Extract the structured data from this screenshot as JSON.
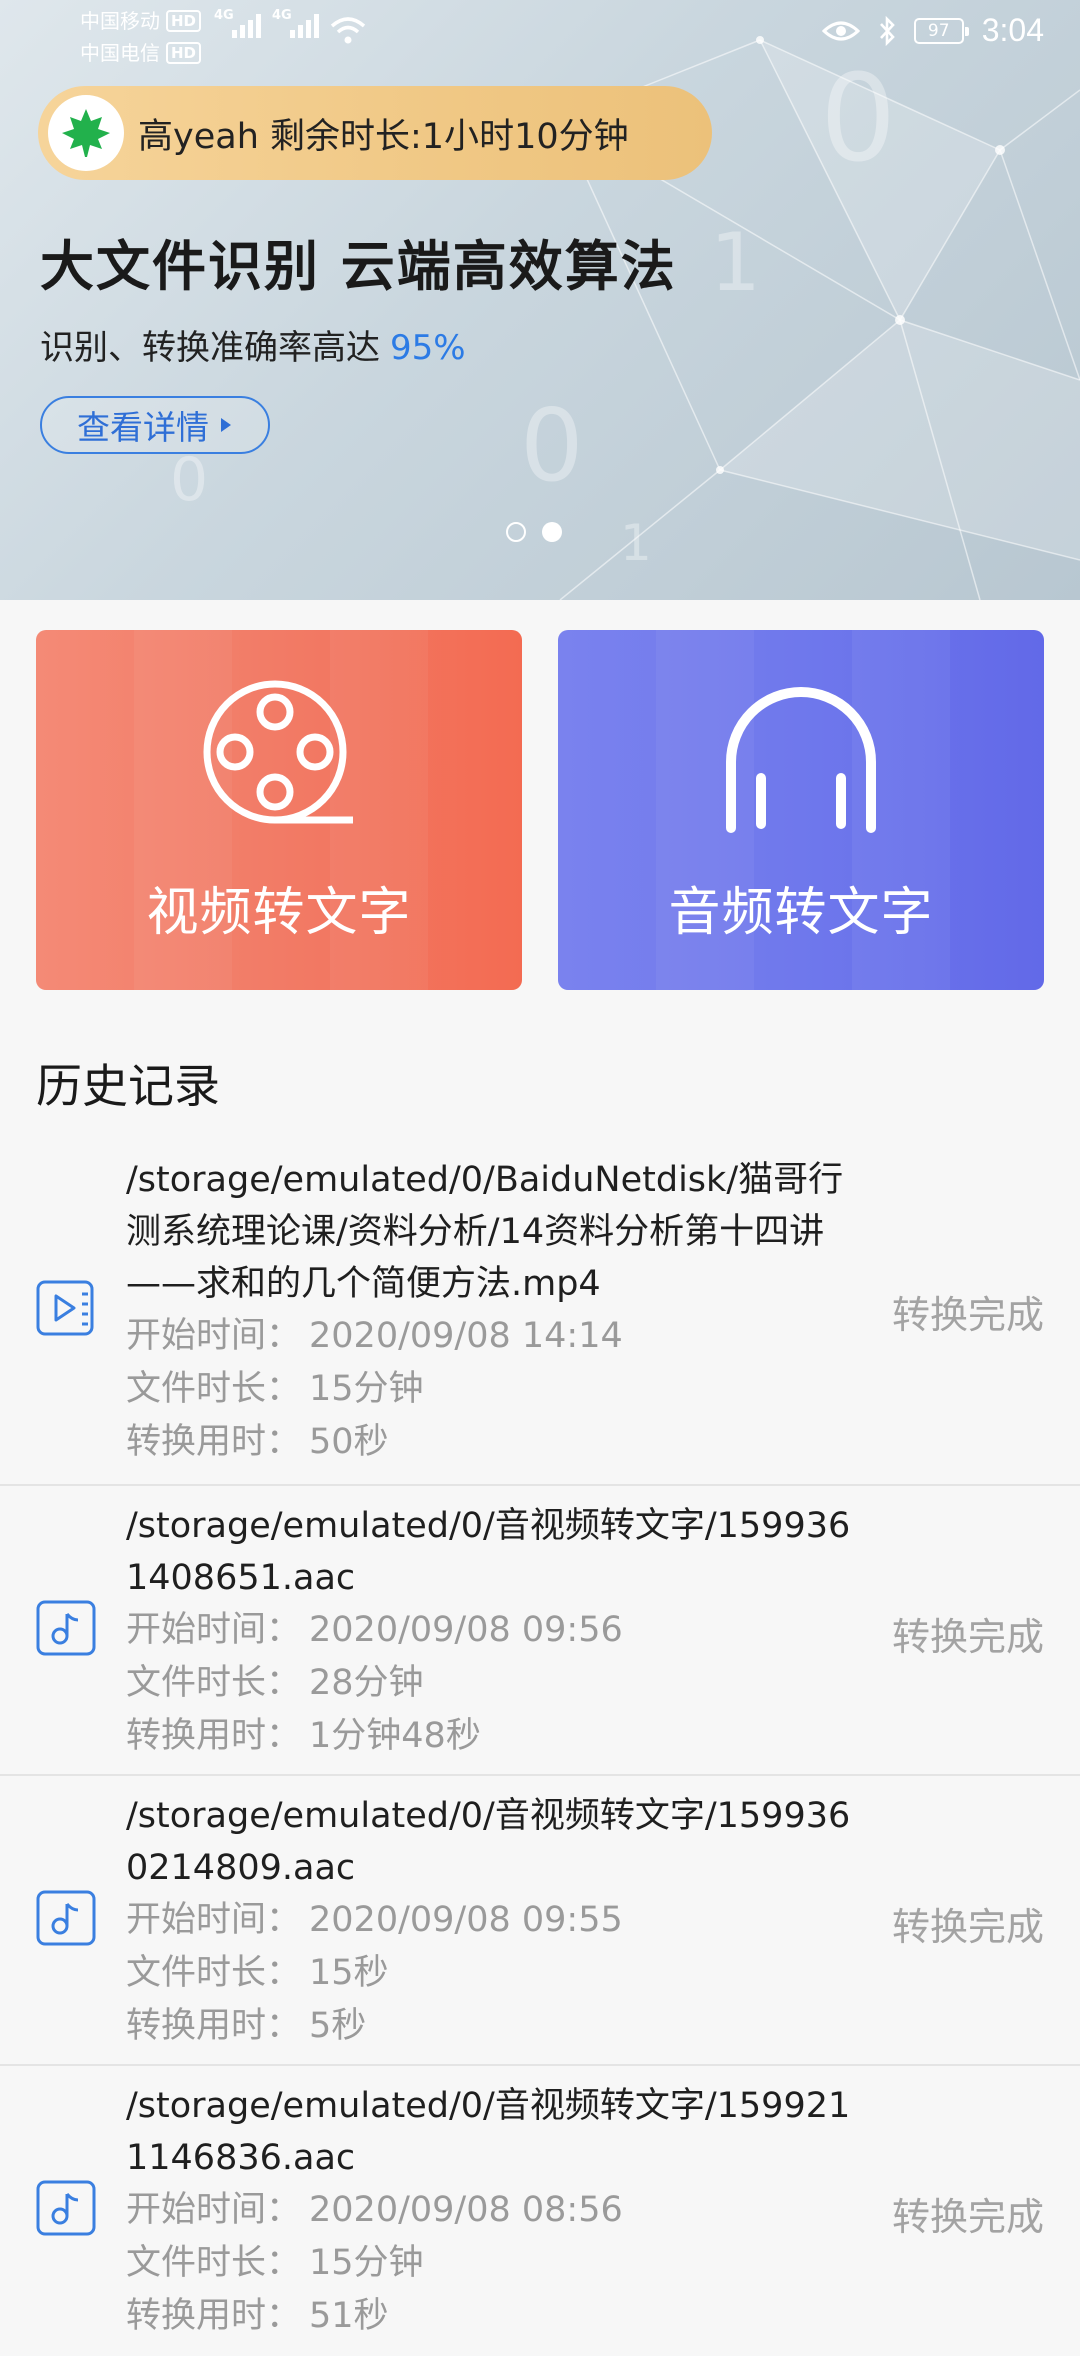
{
  "status_bar": {
    "carrier1": "中国移动",
    "carrier2": "中国电信",
    "hd": "HD",
    "net": "4G",
    "battery": "97",
    "time": "3:04"
  },
  "banner": {
    "vip_text": "高yeah 剩余时长:1小时10分钟",
    "title": "大文件识别 云端高效算法",
    "subtitle": "识别、转换准确率高达",
    "highlight": "95%",
    "details_button": "查看详情",
    "carousel_active_index": 2
  },
  "features": {
    "video_label": "视频转文字",
    "audio_label": "音频转文字"
  },
  "history": {
    "title": "历史记录",
    "items": [
      {
        "type": "video",
        "path": "/storage/emulated/0/BaiduNetdisk/猫哥行测系统理论课/资料分析/14资料分析第十四讲——求和的几个简便方法.mp4",
        "start_label": "开始时间：",
        "start": "2020/09/08 14:14",
        "duration_label": "文件时长：",
        "duration": "15分钟",
        "convert_label": "转换用时：",
        "convert": "50秒",
        "status": "转换完成"
      },
      {
        "type": "audio",
        "path": "/storage/emulated/0/音视频转文字/1599361408651.aac",
        "start_label": "开始时间：",
        "start": "2020/09/08 09:56",
        "duration_label": "文件时长：",
        "duration": "28分钟",
        "convert_label": "转换用时：",
        "convert": "1分钟48秒",
        "status": "转换完成"
      },
      {
        "type": "audio",
        "path": "/storage/emulated/0/音视频转文字/1599360214809.aac",
        "start_label": "开始时间：",
        "start": "2020/09/08 09:55",
        "duration_label": "文件时长：",
        "duration": "15秒",
        "convert_label": "转换用时：",
        "convert": "5秒",
        "status": "转换完成"
      },
      {
        "type": "audio",
        "path": "/storage/emulated/0/音视频转文字/1599211146836.aac",
        "start_label": "开始时间：",
        "start": "2020/09/08 08:56",
        "duration_label": "文件时长：",
        "duration": "15分钟",
        "convert_label": "转换用时：",
        "convert": "51秒",
        "status": "转换完成"
      }
    ]
  },
  "colors": {
    "accent_blue": "#2c7be5",
    "video_card": "#f27b66",
    "audio_card": "#6f78ec",
    "vip_gold": "#f0c885"
  }
}
